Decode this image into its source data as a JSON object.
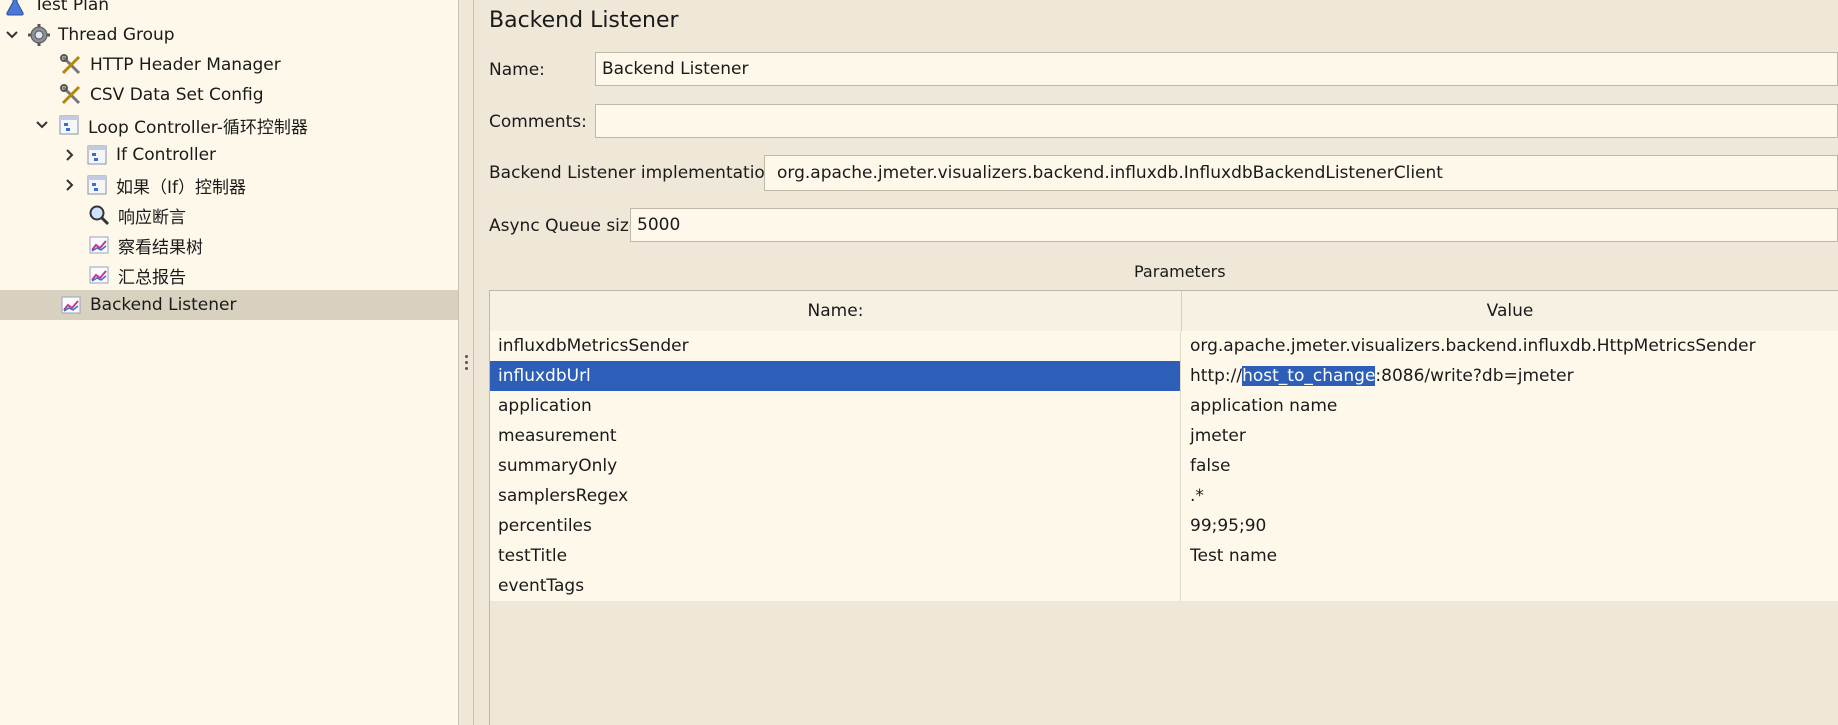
{
  "tree": {
    "items": [
      {
        "label": "Test Plan",
        "icon": "test-plan-icon"
      },
      {
        "label": "Thread Group",
        "icon": "gear-icon"
      },
      {
        "label": "HTTP Header Manager",
        "icon": "wrench-scissors-icon"
      },
      {
        "label": "CSV Data Set Config",
        "icon": "wrench-scissors-icon"
      },
      {
        "label": "Loop Controller-循环控制器",
        "icon": "controller-icon"
      },
      {
        "label": "If Controller",
        "icon": "controller-icon"
      },
      {
        "label": "如果（If）控制器",
        "icon": "controller-icon"
      },
      {
        "label": "响应断言",
        "icon": "magnifier-icon"
      },
      {
        "label": "察看结果树",
        "icon": "graph-icon"
      },
      {
        "label": "汇总报告",
        "icon": "graph-icon"
      },
      {
        "label": "Backend Listener",
        "icon": "graph-icon"
      }
    ]
  },
  "panel": {
    "title": "Backend Listener",
    "name_label": "Name:",
    "name_value": "Backend Listener",
    "comments_label": "Comments:",
    "comments_value": "",
    "impl_label": "Backend Listener implementation",
    "impl_value": "org.apache.jmeter.visualizers.backend.influxdb.InfluxdbBackendListenerClient",
    "queue_label": "Async Queue size",
    "queue_value": "5000"
  },
  "params": {
    "title": "Parameters",
    "header_name": "Name:",
    "header_value": "Value",
    "rows": [
      {
        "name": "influxdbMetricsSender",
        "value": "org.apache.jmeter.visualizers.backend.influxdb.HttpMetricsSender"
      },
      {
        "name": "influxdbUrl",
        "value": "http://host_to_change:8086/write?db=jmeter",
        "value_prefix": "http://",
        "value_highlight": "host_to_change",
        "value_suffix": ":8086/write?db=jmeter"
      },
      {
        "name": "application",
        "value": "application name"
      },
      {
        "name": "measurement",
        "value": "jmeter"
      },
      {
        "name": "summaryOnly",
        "value": "false"
      },
      {
        "name": "samplersRegex",
        "value": ".*"
      },
      {
        "name": "percentiles",
        "value": "99;95;90"
      },
      {
        "name": "testTitle",
        "value": "Test name"
      },
      {
        "name": "eventTags",
        "value": ""
      }
    ]
  },
  "colors": {
    "selection": "#2e5fb8",
    "panel_bg": "#efe8d8",
    "field_bg": "#fdf8ea"
  }
}
